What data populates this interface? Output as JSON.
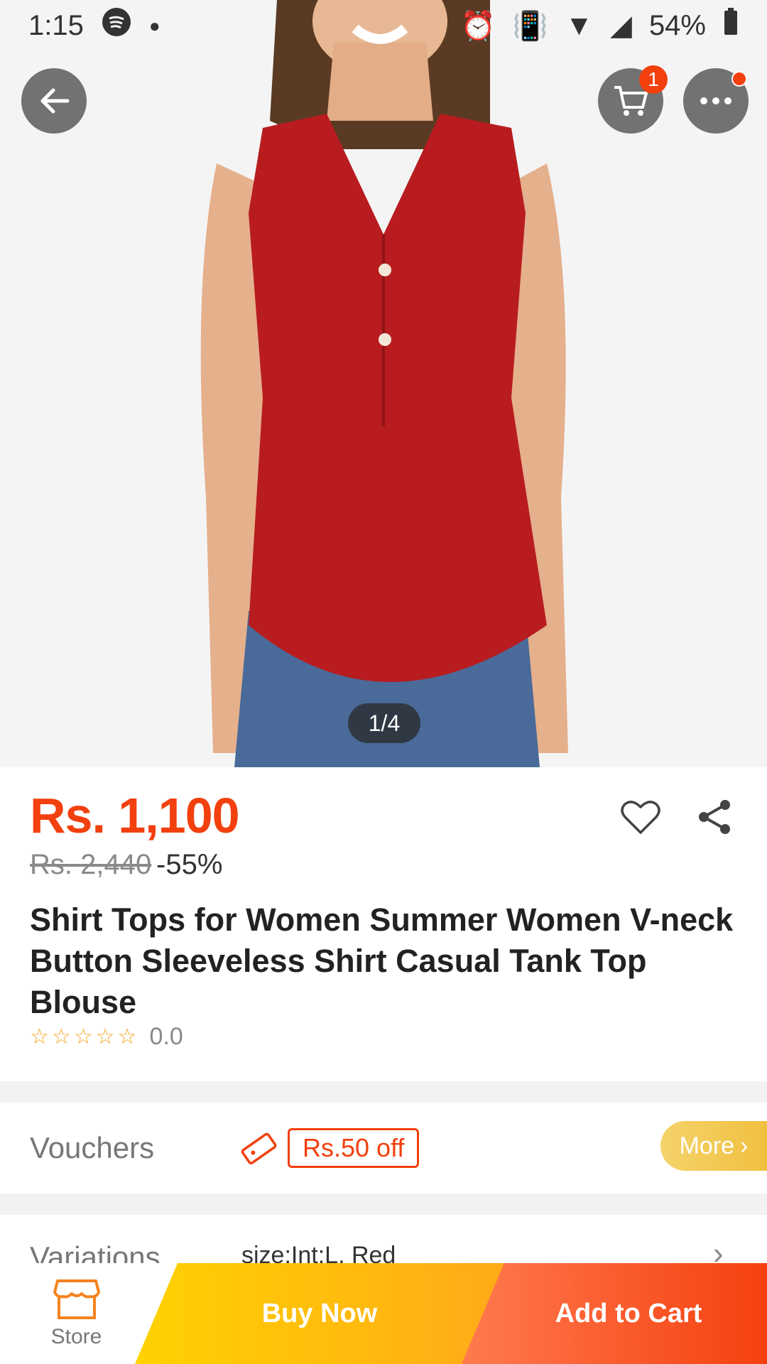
{
  "status_bar": {
    "time": "1:15",
    "battery": "54%"
  },
  "header": {
    "cart_count": "1"
  },
  "gallery": {
    "pager": "1/4"
  },
  "product": {
    "price": "Rs. 1,100",
    "original_price": "Rs. 2,440",
    "discount": "-55%",
    "title": "Shirt Tops for Women Summer Women V-neck Button Sleeveless Shirt Casual Tank Top Blouse",
    "rating": "0.0"
  },
  "vouchers": {
    "label": "Vouchers",
    "tag": "Rs.50 off",
    "more": "More"
  },
  "variations": {
    "label": "Variations",
    "value": "size:Int:L, Red"
  },
  "bottom_bar": {
    "store": "Store",
    "buy_now": "Buy Now",
    "add_to_cart": "Add to Cart"
  },
  "colors": {
    "accent": "#f2400e",
    "buy": "#ffc107",
    "cart": "#f5400e"
  }
}
